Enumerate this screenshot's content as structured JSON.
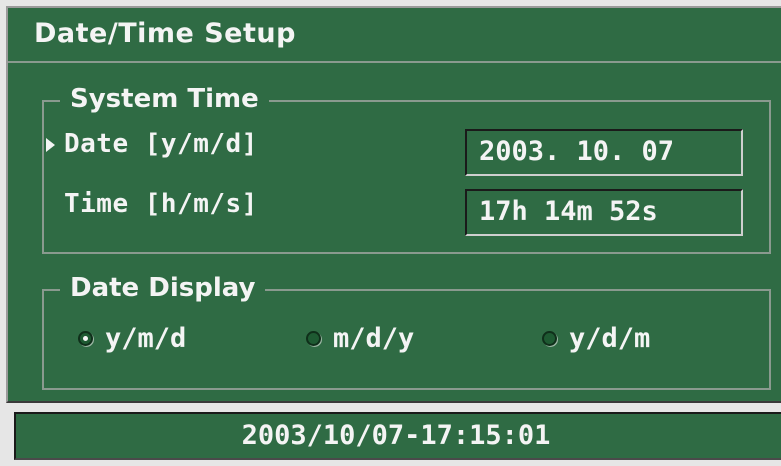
{
  "window": {
    "title": "Date/Time Setup"
  },
  "system_time": {
    "legend": "System Time",
    "date": {
      "label": "Date [y/m/d]",
      "value": "2003. 10. 07",
      "focused": true
    },
    "time": {
      "label": "Time [h/m/s]",
      "value": "17h 14m 52s"
    }
  },
  "date_display": {
    "legend": "Date Display",
    "options": [
      {
        "label": "y/m/d",
        "selected": true
      },
      {
        "label": "m/d/y",
        "selected": false
      },
      {
        "label": "y/d/m",
        "selected": false
      }
    ]
  },
  "status_bar": {
    "datetime": "2003/10/07-17:15:01"
  },
  "colors": {
    "panel_bg": "#2f6b44",
    "text": "#f4f4f4",
    "frame": "#8a9a8f",
    "page_bg": "#e6e6e6"
  },
  "icons": {
    "focus_pointer": "focus-pointer-icon",
    "radio": "radio-button-icon"
  }
}
